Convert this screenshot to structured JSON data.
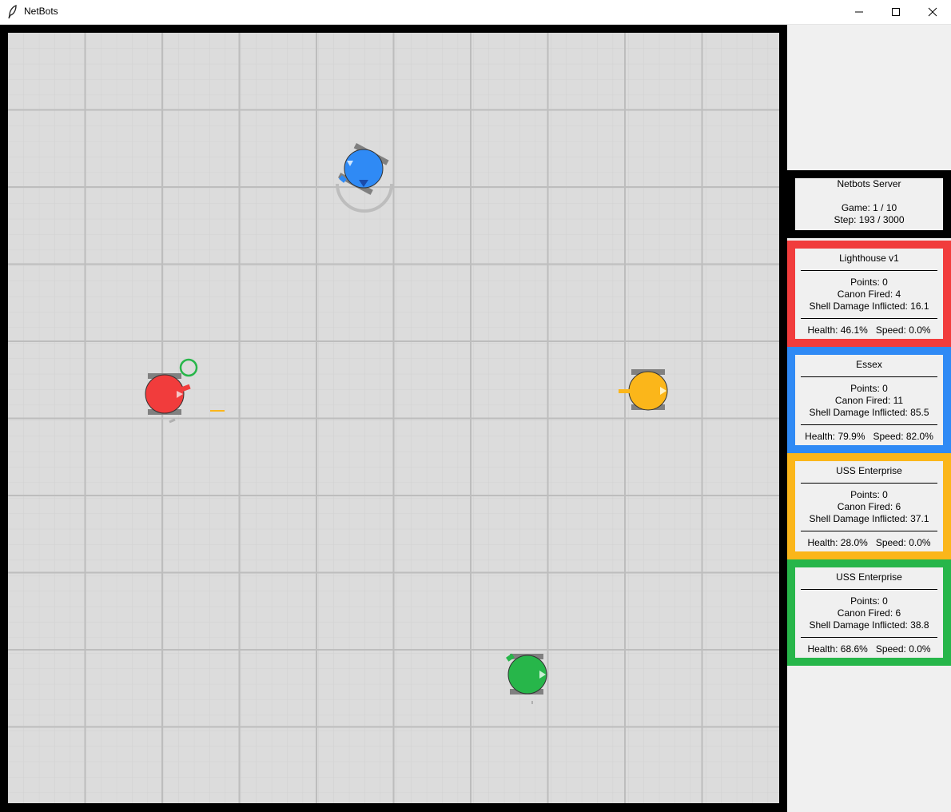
{
  "window": {
    "title": "NetBots",
    "app_icon": "feather-icon",
    "controls": [
      "minimize-icon",
      "maximize-icon",
      "close-icon"
    ]
  },
  "server": {
    "title": "Netbots Server",
    "game": "Game: 1 / 10",
    "step": "Step: 193 / 3000"
  },
  "bots": [
    {
      "name": "Lighthouse v1",
      "color": "#f13c3c",
      "points": "Points: 0",
      "canon": "Canon Fired: 4",
      "damage": "Shell Damage Inflicted: 16.1",
      "status": "Health: 46.1%   Speed: 0.0%"
    },
    {
      "name": "Essex",
      "color": "#2f8af5",
      "points": "Points: 0",
      "canon": "Canon Fired: 11",
      "damage": "Shell Damage Inflicted: 85.5",
      "status": "Health: 79.9%   Speed: 82.0%"
    },
    {
      "name": "USS Enterprise",
      "color": "#fbb61a",
      "points": "Points: 0",
      "canon": "Canon Fired: 6",
      "damage": "Shell Damage Inflicted: 37.1",
      "status": "Health: 28.0%   Speed: 0.0%"
    },
    {
      "name": "USS Enterprise",
      "color": "#27b64a",
      "points": "Points: 0",
      "canon": "Canon Fired: 6",
      "damage": "Shell Damage Inflicted: 38.8",
      "status": "Health: 68.6%   Speed: 0.0%"
    }
  ]
}
